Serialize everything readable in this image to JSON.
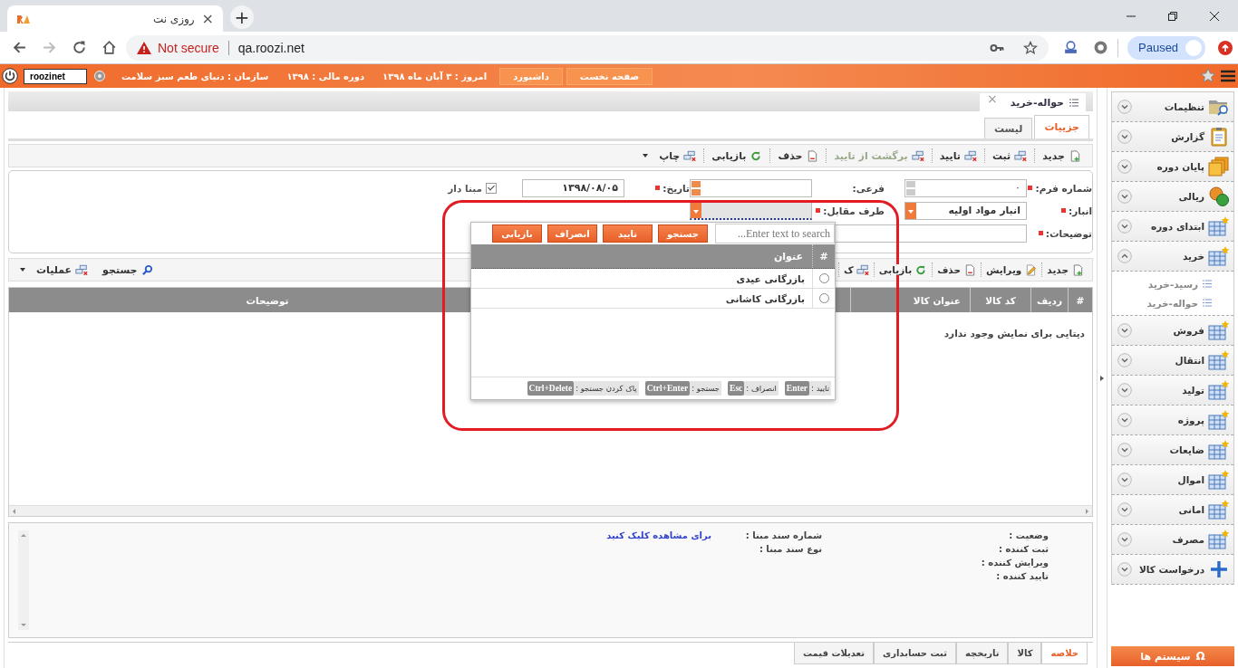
{
  "browser": {
    "tab": {
      "title": "روزی نت",
      "close": "×"
    },
    "new_tab": "+",
    "security_label": "Not secure",
    "url": "qa.roozi.net",
    "profile_status": "Paused"
  },
  "app_bar": {
    "nav_buttons": [
      "صفحه نخست",
      "داشبورد"
    ],
    "info": [
      "امروز : ۳ آبان ماه ۱۳۹۸",
      "دوره مالی : ۱۳۹۸",
      "سازمان : دنیای طعم سبز سلامت"
    ],
    "user": "roozinet"
  },
  "document_tab": {
    "title": "حواله-خرید",
    "close": "×"
  },
  "view_tabs": [
    {
      "label": "جزییات",
      "selected": true
    },
    {
      "label": "لیست",
      "selected": false
    }
  ],
  "toolbar": [
    {
      "label": "جدید",
      "kind": "new",
      "disabled": false,
      "menu": false
    },
    {
      "label": "ثبت",
      "kind": "save",
      "disabled": false,
      "menu": false
    },
    {
      "label": "تایید",
      "kind": "approve",
      "disabled": false,
      "menu": false
    },
    {
      "label": "برگشت از تایید",
      "kind": "revert",
      "disabled": true,
      "menu": false
    },
    {
      "label": "حذف",
      "kind": "delete",
      "disabled": false,
      "menu": false
    },
    {
      "label": "بازیابی",
      "kind": "reload",
      "disabled": false,
      "menu": false
    },
    {
      "label": "چاپ",
      "kind": "print",
      "disabled": false,
      "menu": true
    }
  ],
  "form": {
    "form_number": {
      "label": "شماره فرم:",
      "required": true,
      "value": "۰"
    },
    "branch": {
      "label": "فرعی:",
      "required": false
    },
    "date": {
      "label": "تاریخ:",
      "required": true,
      "value": "۱۳۹۸/۰۸/۰۵"
    },
    "based": {
      "label": "مبنا دار",
      "checked": true
    },
    "warehouse": {
      "label": "انبار:",
      "required": true,
      "value": "انبار مواد اولیه"
    },
    "counterparty": {
      "label": "طرف مقابل:",
      "required": true,
      "open": true
    },
    "description": {
      "label": "توضیحات:",
      "required": true
    }
  },
  "picker": {
    "search_placeholder": "Enter text to search...",
    "buttons": [
      "جستجو",
      "تایید",
      "انصراف",
      "بازیابی"
    ],
    "columns": [
      "#",
      "عنوان"
    ],
    "rows": [
      {
        "title": "بازرگانی عیدی",
        "selected": false
      },
      {
        "title": "بازرگانی کاشانی",
        "selected": false
      }
    ],
    "shortcuts": [
      {
        "action": "تایید :",
        "key": "Enter"
      },
      {
        "action": "انصراف :",
        "key": "Esc"
      },
      {
        "action": "جستجو :",
        "key": "Ctrl+Enter"
      },
      {
        "action": "پاک کردن جستجو :",
        "key": "Ctrl+Delete"
      }
    ]
  },
  "items_toolbar": [
    {
      "label": "جدید",
      "kind": "new",
      "menu": false
    },
    {
      "label": "ویرایش",
      "kind": "edit",
      "menu": false
    },
    {
      "label": "حذف",
      "kind": "delete",
      "menu": false
    },
    {
      "label": "بازیابی",
      "kind": "reload",
      "menu": false
    },
    {
      "label": "ک",
      "kind": "copy",
      "menu": false
    }
  ],
  "items_tools": [
    {
      "label": "جستجو",
      "kind": "search",
      "menu": false
    },
    {
      "label": "عملیات",
      "kind": "actions",
      "menu": true
    }
  ],
  "grid": {
    "columns": [
      "#",
      "ردیف",
      "کد کالا",
      "عنوان کالا",
      "توضیحات"
    ],
    "empty_message": "دیتایی برای نمایش وجود ندارد"
  },
  "details": {
    "status_labels": [
      "وضعیت :",
      "ثبت کننده :",
      "ویرایش کننده :",
      "تایید کننده :"
    ],
    "source_labels": [
      "شماره سند مبنا :",
      "نوع سند مبنا :"
    ],
    "source_link": "برای مشاهده کلیک کنید"
  },
  "bottom_tabs": [
    {
      "label": "خلاصه",
      "selected": true
    },
    {
      "label": "کالا",
      "selected": false
    },
    {
      "label": "تاریخچه",
      "selected": false
    },
    {
      "label": "ثبت حسابداری",
      "selected": false
    },
    {
      "label": "تعدیلات قیمت",
      "selected": false
    }
  ],
  "sidebar": {
    "items": [
      {
        "label": "تنظیمات",
        "kind": "settings",
        "expanded": false
      },
      {
        "label": "گزارش",
        "kind": "report",
        "expanded": false
      },
      {
        "label": "پایان دوره",
        "kind": "archive",
        "expanded": false
      },
      {
        "label": "ریالی",
        "kind": "currency",
        "expanded": false
      },
      {
        "label": "ابتدای دوره",
        "kind": "table",
        "expanded": false
      },
      {
        "label": "خرید",
        "kind": "table",
        "expanded": true,
        "children": [
          {
            "label": "رسید-خرید",
            "selected": false
          },
          {
            "label": "حواله-خرید",
            "selected": false
          }
        ]
      },
      {
        "label": "فروش",
        "kind": "table",
        "expanded": false
      },
      {
        "label": "انتقال",
        "kind": "table",
        "expanded": false
      },
      {
        "label": "تولید",
        "kind": "table",
        "expanded": false
      },
      {
        "label": "پروژه",
        "kind": "table",
        "expanded": false
      },
      {
        "label": "ضایعات",
        "kind": "table",
        "expanded": false
      },
      {
        "label": "اموال",
        "kind": "table",
        "expanded": false
      },
      {
        "label": "امانی",
        "kind": "table",
        "expanded": false
      },
      {
        "label": "مصرف",
        "kind": "table",
        "expanded": false
      },
      {
        "label": "درخواست کالا",
        "kind": "add",
        "expanded": false
      }
    ],
    "footer": {
      "label": "سیستم ها",
      "icon": "Ω"
    }
  },
  "annotation": {
    "visible": true
  }
}
